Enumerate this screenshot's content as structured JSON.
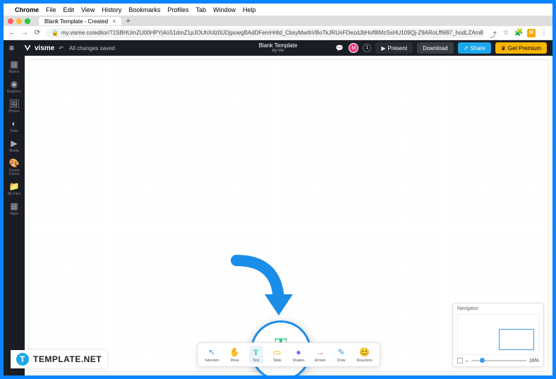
{
  "menubar": {
    "app": "Chrome",
    "items": [
      "File",
      "Edit",
      "View",
      "History",
      "Bookmarks",
      "Profiles",
      "Tab",
      "Window",
      "Help"
    ]
  },
  "browser": {
    "tab_title": "Blank Template - Created",
    "url": "my.visme.co/editor/71SBHUmZU00HPYj4oS1dmZ1pJOUhXdz0UDjpowgBAdDFemHr8d_CbsyMw/bVBoTkJRUnFDezdJbHof8IMzSsHU109Qj-Z9ARoLff6l97_hodLZAm8"
  },
  "app": {
    "saved": "All changes saved",
    "title": "Blank Template",
    "subtitle": "By Me",
    "avatar": "M",
    "badge": "1",
    "buttons": {
      "present": "Present",
      "download": "Download",
      "share": "Share",
      "premium": "Get Premium"
    }
  },
  "sidebar": [
    {
      "icon": "▦",
      "label": "Basics"
    },
    {
      "icon": "◉",
      "label": "Graphics"
    },
    {
      "icon": "🖼",
      "label": "Photos"
    },
    {
      "icon": "◐",
      "label": "Data"
    },
    {
      "icon": "▶",
      "label": "Media"
    },
    {
      "icon": "🎨",
      "label": "Theme Colors"
    },
    {
      "icon": "📁",
      "label": "My Files"
    },
    {
      "icon": "▦",
      "label": "Apps"
    }
  ],
  "highlight": {
    "glyph": "T",
    "label": "Text"
  },
  "bottom_toolbar": [
    {
      "icon": "↖",
      "label": "Selection",
      "color": "#3d9aea"
    },
    {
      "icon": "✋",
      "label": "Move",
      "color": "#888"
    },
    {
      "icon": "T",
      "label": "Text",
      "color": "#37c88a",
      "active": true
    },
    {
      "icon": "▭",
      "label": "Table",
      "color": "#f7b500"
    },
    {
      "icon": "●",
      "label": "Shapes",
      "color": "#7f5fff"
    },
    {
      "icon": "→",
      "label": "Arrows",
      "color": "#e74c3c"
    },
    {
      "icon": "✎",
      "label": "Draw",
      "color": "#3d9aea"
    },
    {
      "icon": "😊",
      "label": "Reactions",
      "color": "#f7b500"
    }
  ],
  "navigator": {
    "title": "Navigator",
    "zoom": "16%"
  },
  "watermark": "TEMPLATE.NET"
}
